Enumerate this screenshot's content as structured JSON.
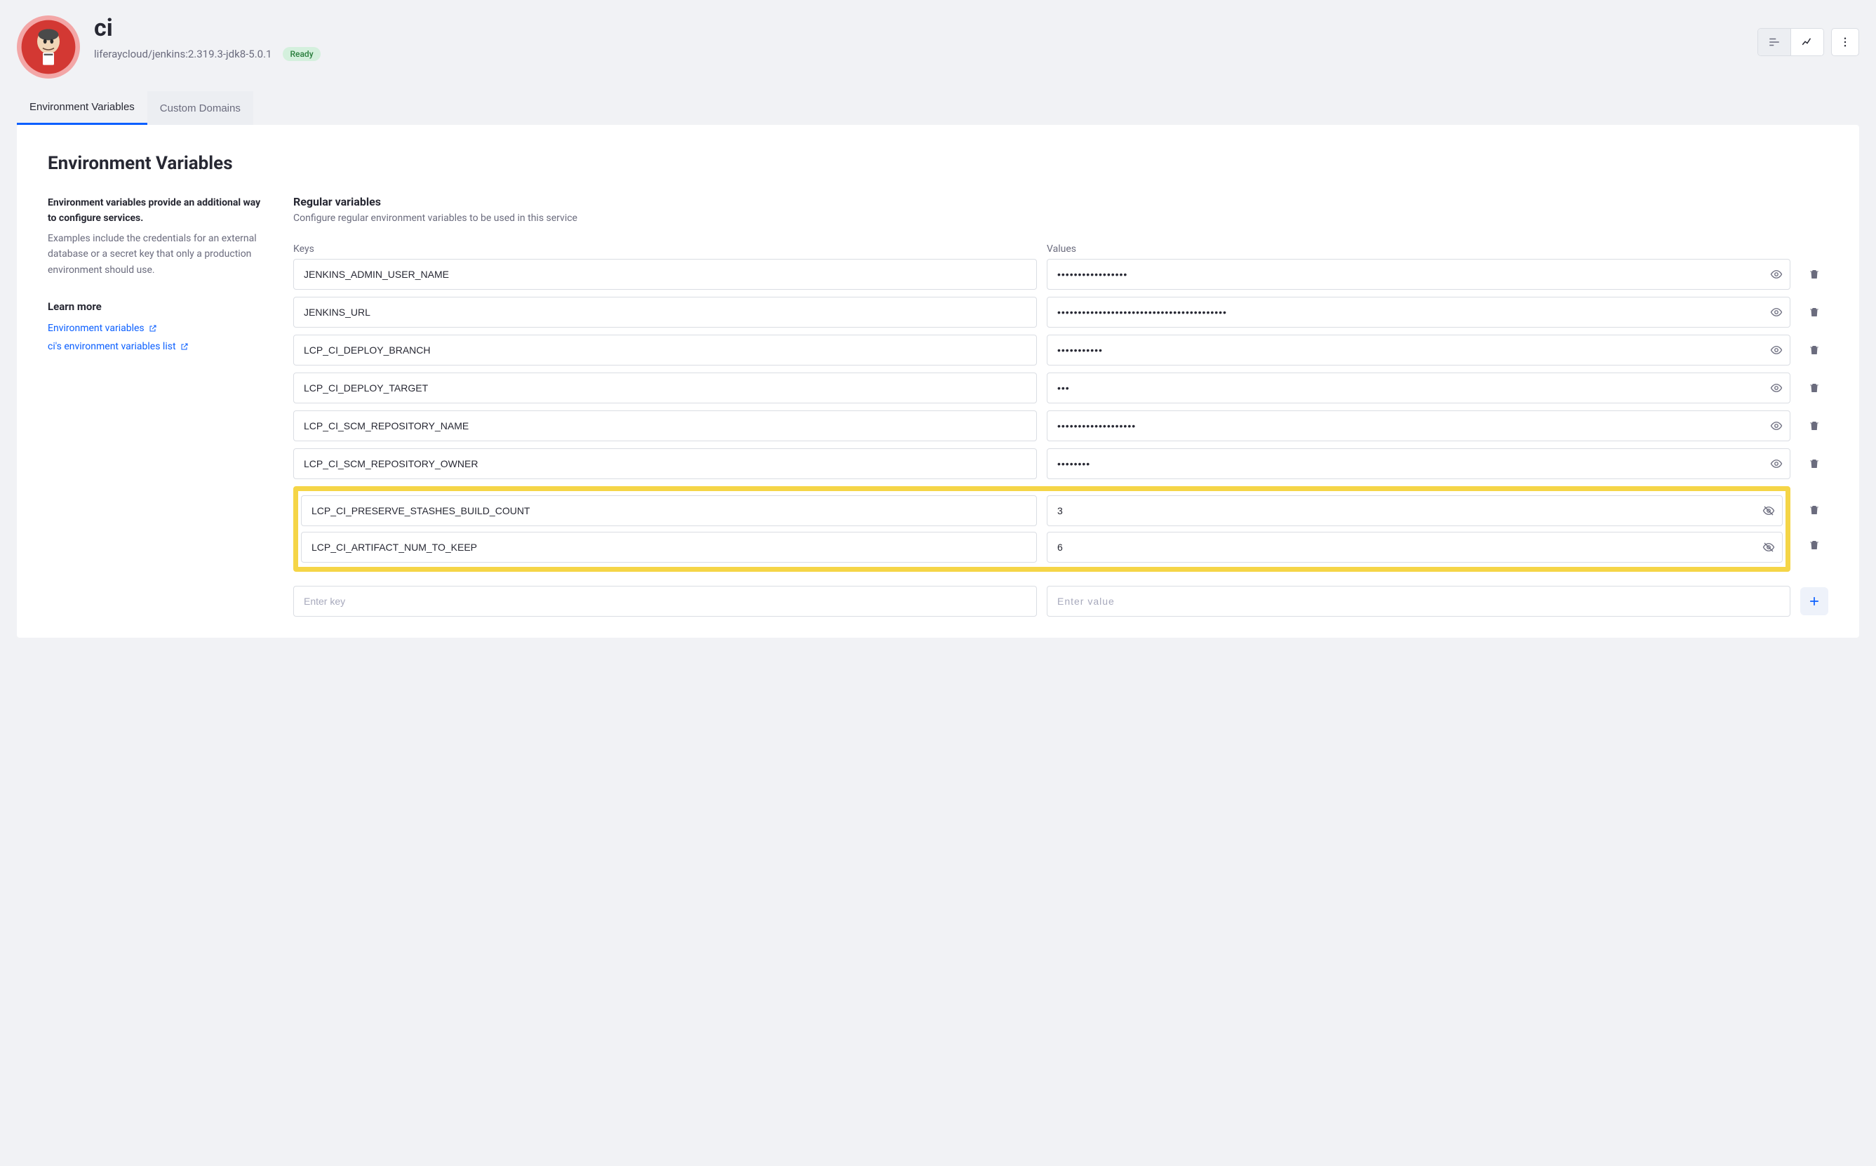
{
  "header": {
    "title": "ci",
    "subtitle": "liferaycloud/jenkins:2.319.3-jdk8-5.0.1",
    "badge": "Ready"
  },
  "tabs": [
    {
      "label": "Environment Variables",
      "active": true
    },
    {
      "label": "Custom Domains",
      "active": false
    }
  ],
  "panel": {
    "title": "Environment Variables",
    "intro_bold": "Environment variables provide an additional way to configure services.",
    "intro_rest": "Examples include the credentials for an external database or a secret key that only a production environment should use.",
    "learn_more": "Learn more",
    "links": [
      {
        "label": "Environment variables"
      },
      {
        "label": "ci's environment variables list"
      }
    ],
    "section_title": "Regular variables",
    "section_desc": "Configure regular environment variables to be used in this service",
    "col_keys": "Keys",
    "col_values": "Values",
    "key_placeholder": "Enter key",
    "value_placeholder": "Enter value"
  },
  "rows": [
    {
      "key": "JENKINS_ADMIN_USER_NAME",
      "value": "•••••••••••••••••",
      "masked": true
    },
    {
      "key": "JENKINS_URL",
      "value": "•••••••••••••••••••••••••••••••••••••••••",
      "masked": true
    },
    {
      "key": "LCP_CI_DEPLOY_BRANCH",
      "value": "•••••••••••",
      "masked": true
    },
    {
      "key": "LCP_CI_DEPLOY_TARGET",
      "value": "•••",
      "masked": true
    },
    {
      "key": "LCP_CI_SCM_REPOSITORY_NAME",
      "value": "•••••••••••••••••••",
      "masked": true
    },
    {
      "key": "LCP_CI_SCM_REPOSITORY_OWNER",
      "value": "••••••••",
      "masked": true
    }
  ],
  "highlighted": [
    {
      "key": "LCP_CI_PRESERVE_STASHES_BUILD_COUNT",
      "value": "3",
      "masked": false
    },
    {
      "key": "LCP_CI_ARTIFACT_NUM_TO_KEEP",
      "value": "6",
      "masked": false
    }
  ]
}
